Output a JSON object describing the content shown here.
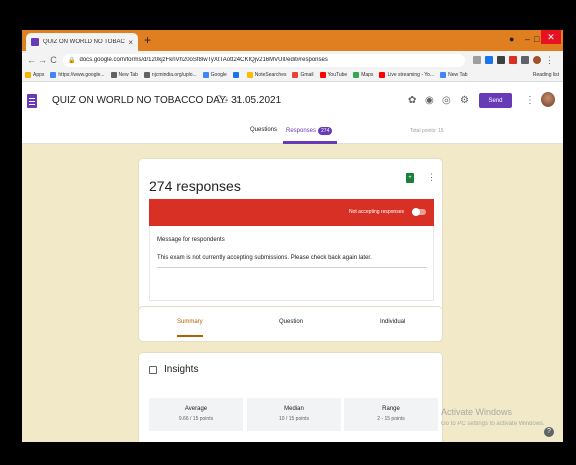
{
  "browser": {
    "tab_title": "QUIZ ON WORLD NO TOBACCO",
    "tab_close": "×",
    "new_tab": "+",
    "url": "docs.google.com/forms/d/120kjzFknVh20oSf8lwTyXtTAott24CKIQjv216MVUlI/edit#responses",
    "nav": {
      "back": "←",
      "forward": "→",
      "reload": "C"
    },
    "lock_icon": "lock-icon",
    "bookmarks": [
      {
        "label": "Apps",
        "color": "#f4b400"
      },
      {
        "label": "https://www.google...",
        "color": "#4285f4"
      },
      {
        "label": "New Tab",
        "color": "#5f6368"
      },
      {
        "label": "njcmindia.org/uplo...",
        "color": "#5f6368"
      },
      {
        "label": "Google",
        "color": "#4285f4"
      },
      {
        "label": "",
        "color": "#1a73e8"
      },
      {
        "label": "NoteSearches",
        "color": "#fbbc04"
      },
      {
        "label": "Gmail",
        "color": "#ea4335"
      },
      {
        "label": "YouTube",
        "color": "#ff0000"
      },
      {
        "label": "Maps",
        "color": "#34a853"
      },
      {
        "label": "Live streaming - Yo...",
        "color": "#ff0000"
      },
      {
        "label": "New Tab",
        "color": "#4285f4"
      }
    ],
    "reading_list": "Reading list"
  },
  "form": {
    "title": "QUIZ ON WORLD NO TOBACCO DAY- 31.05.2021",
    "send_label": "Send",
    "tabs": {
      "questions": "Questions",
      "responses": "Responses",
      "responses_count": "274"
    },
    "total_points": "Total points: 15"
  },
  "responses": {
    "title": "274 responses",
    "not_accepting": "Not accepting responses",
    "message_label": "Message for respondents",
    "message_text": "This exam is not currently accepting submissions. Please check back again later.",
    "subtabs": {
      "summary": "Summary",
      "question": "Question",
      "individual": "Individual"
    }
  },
  "insights": {
    "title": "Insights",
    "stats": [
      {
        "label": "Average",
        "value": "9.66 / 15 points"
      },
      {
        "label": "Median",
        "value": "10 / 15 points"
      },
      {
        "label": "Range",
        "value": "2 - 15 points"
      }
    ]
  },
  "watermark": {
    "title": "Activate Windows",
    "subtitle": "Go to PC settings to activate Windows."
  },
  "colors": {
    "accent": "#673ab7",
    "banner": "#d93025",
    "background": "#f1e9c8",
    "tabstrip": "#df7f1f"
  }
}
